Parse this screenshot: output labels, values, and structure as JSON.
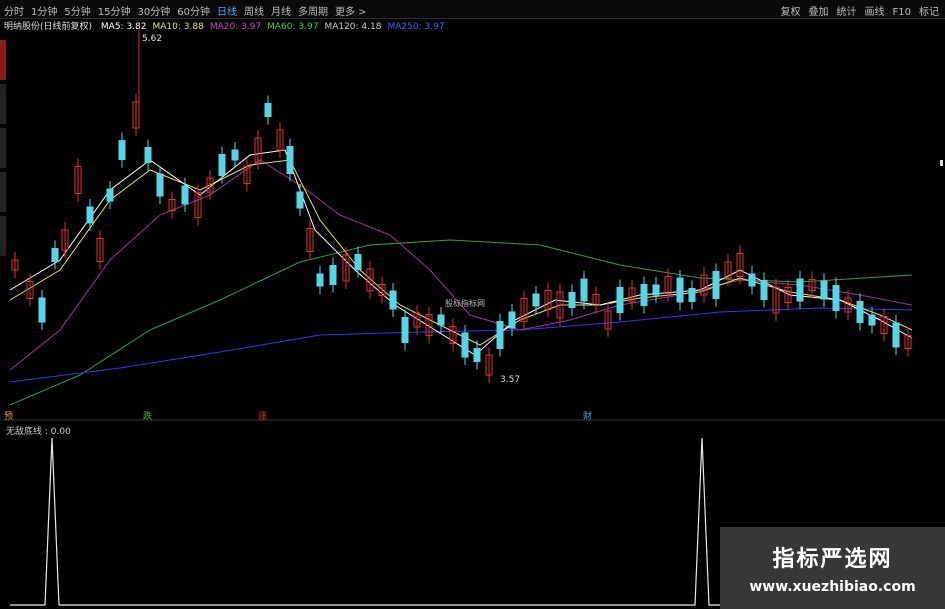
{
  "toolbar": {
    "periods": [
      "分时",
      "1分钟",
      "5分钟",
      "15分钟",
      "30分钟",
      "60分钟",
      "日线",
      "周线",
      "月线",
      "多周期",
      "更多 >"
    ],
    "active_period": "日线",
    "right": [
      "复权",
      "叠加",
      "统计",
      "画线",
      "F10",
      "标记"
    ]
  },
  "main_chart": {
    "title": "明纳股份(日线前复权)",
    "ma": [
      {
        "label": "MA5: 3.82",
        "color": "#ffffff"
      },
      {
        "label": "MA10: 3.88",
        "color": "#e8e060"
      },
      {
        "label": "MA20: 3.97",
        "color": "#d040d0"
      },
      {
        "label": "MA60: 3.97",
        "color": "#40d040"
      },
      {
        "label": "MA120: 4.18",
        "color": "#cccccc"
      },
      {
        "label": "MA250: 3.97",
        "color": "#4060ff"
      }
    ],
    "high_label": "5.62",
    "low_label": "3.57",
    "watermark_text": "股标指标网",
    "markers": [
      "预",
      "跌",
      "涨",
      "财"
    ]
  },
  "sub_chart": {
    "title": "无敌底线 : 0.00"
  },
  "watermark": {
    "cn": "指标严选网",
    "url": "www.xuezhibiao.com"
  },
  "colors": {
    "up": "#e03030",
    "down": "#54d6e8",
    "ma60": "#3a9a3a",
    "ma250": "#2a3aff",
    "ma20": "#a030a0"
  }
}
